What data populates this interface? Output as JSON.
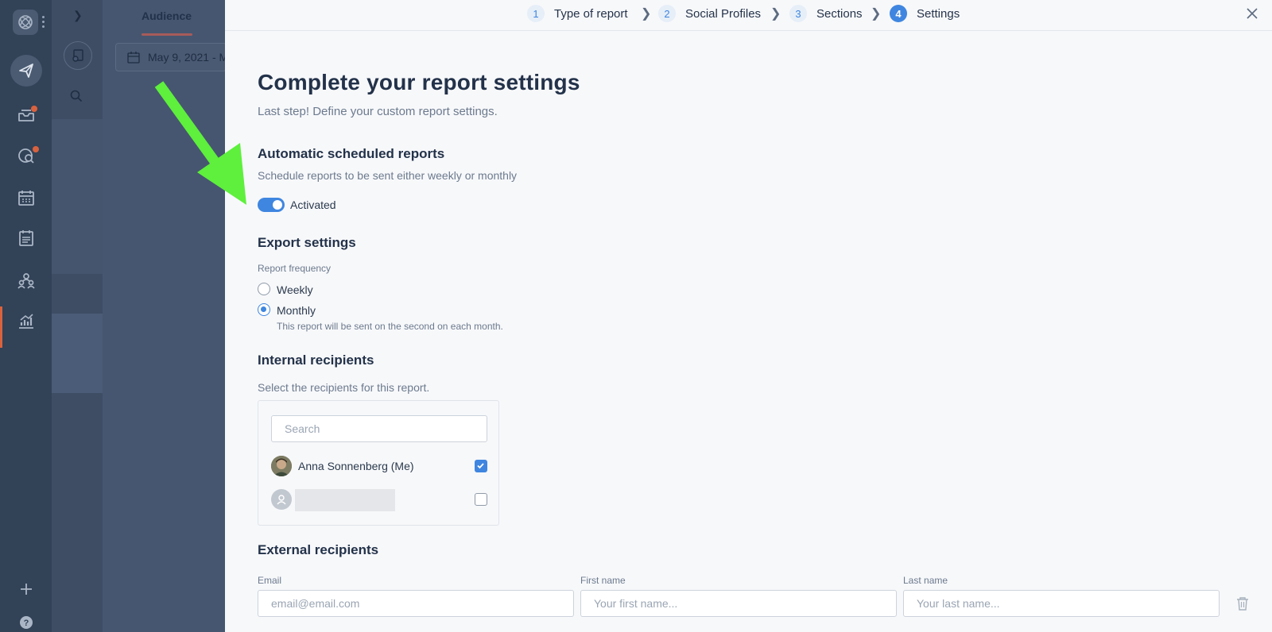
{
  "app": {
    "accent_color": "#3f86e0",
    "nav_color": "#324257"
  },
  "nav": {
    "items": [
      "compose-icon",
      "inbox-icon",
      "listening-icon",
      "calendar-icon",
      "content-icon",
      "team-icon",
      "reports-icon"
    ],
    "bottom": [
      "add-icon",
      "help-icon"
    ]
  },
  "background": {
    "tab": "Audience",
    "date": "May 9, 2021 - M"
  },
  "stepper": {
    "steps": [
      {
        "num": "1",
        "label": "Type of report"
      },
      {
        "num": "2",
        "label": "Social Profiles"
      },
      {
        "num": "3",
        "label": "Sections"
      },
      {
        "num": "4",
        "label": "Settings"
      }
    ]
  },
  "page": {
    "title": "Complete your report settings",
    "subtitle": "Last step! Define your custom report settings."
  },
  "scheduled": {
    "title": "Automatic scheduled reports",
    "desc": "Schedule reports to be sent either weekly or monthly",
    "toggle_label": "Activated",
    "toggle_on": true
  },
  "export": {
    "title": "Export settings",
    "freq_label": "Report frequency",
    "options": [
      {
        "label": "Weekly",
        "selected": false
      },
      {
        "label": "Monthly",
        "selected": true
      }
    ],
    "help": "This report will be sent on the second on each month."
  },
  "internal": {
    "title": "Internal recipients",
    "desc": "Select the recipients for this report.",
    "search_placeholder": "Search",
    "recipients": [
      {
        "name": "Anna Sonnenberg (Me)",
        "checked": true
      },
      {
        "name": "",
        "checked": false
      }
    ]
  },
  "external": {
    "title": "External recipients",
    "email_label": "Email",
    "email_placeholder": "email@email.com",
    "first_label": "First name",
    "first_placeholder": "Your first name...",
    "last_label": "Last name",
    "last_placeholder": "Your last name..."
  }
}
